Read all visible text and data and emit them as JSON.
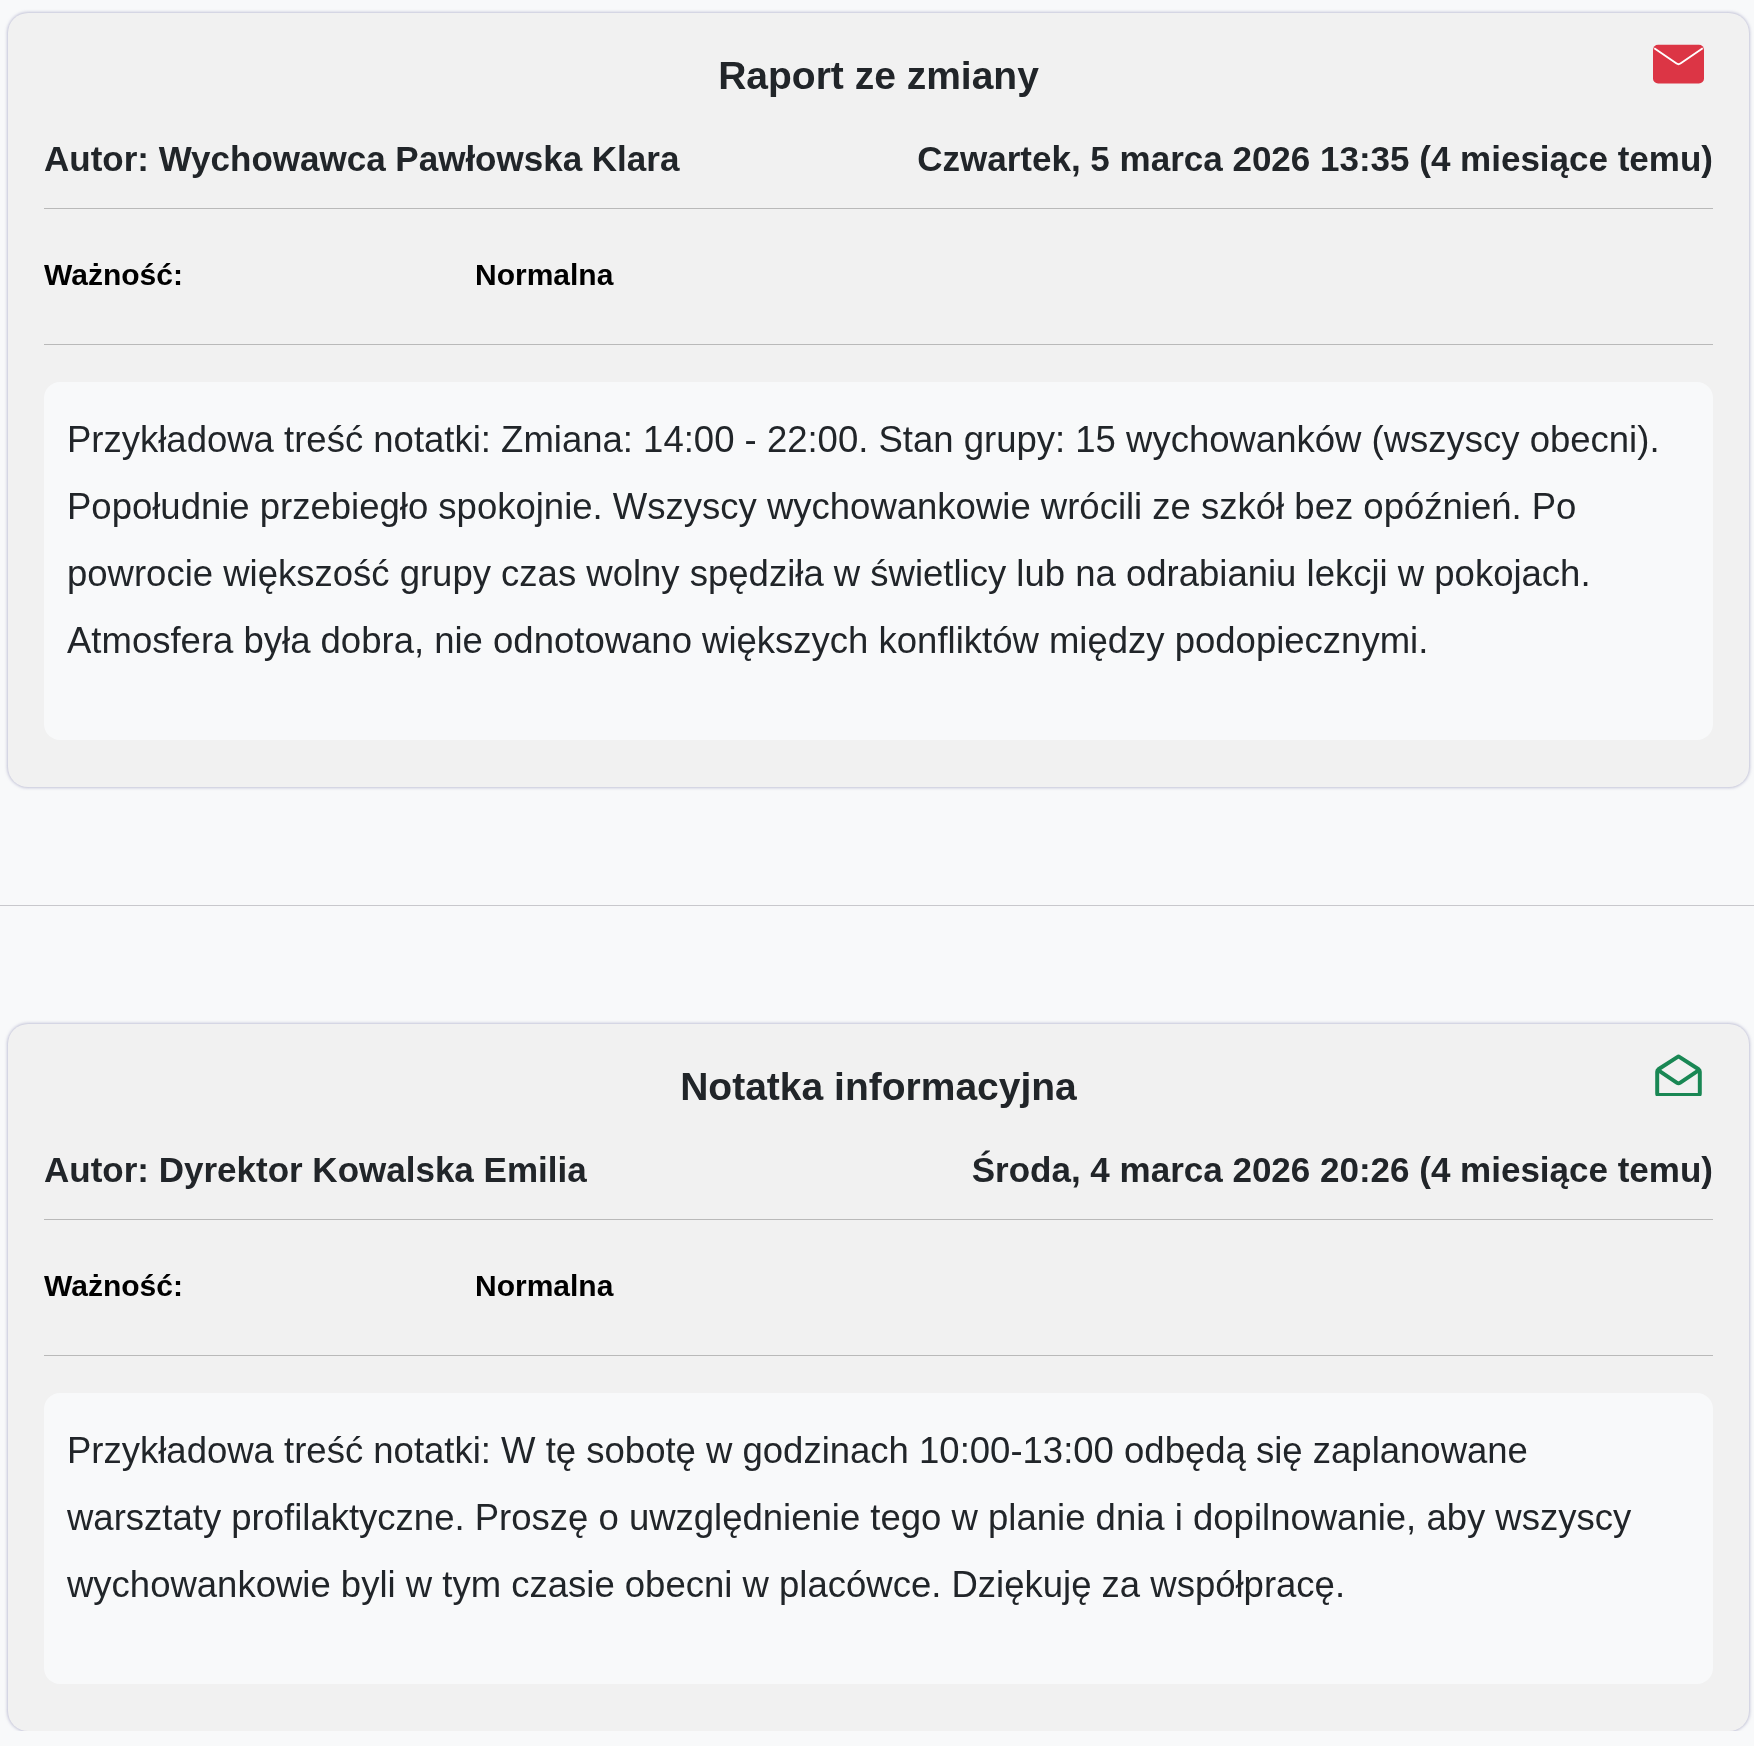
{
  "notes": [
    {
      "title": "Raport ze zmiany",
      "read": false,
      "author": "Autor: Wychowawca Pawłowska Klara",
      "date": "Czwartek, 5 marca 2026 13:35 (4 miesiące temu)",
      "fields": [
        {
          "label": "Ważność:",
          "value": "Normalna"
        }
      ],
      "body": "Przykładowa treść notatki: Zmiana: 14:00 - 22:00. Stan grupy: 15 wychowanków (wszyscy obecni). Popołudnie przebiegło spokojnie. Wszyscy wychowankowie wrócili ze szkół bez opóźnień. Po powrocie większość grupy czas wolny spędziła w świetlicy lub na odrabianiu lekcji w pokojach. Atmosfera była dobra, nie odnotowano większych konfliktów między podopiecznymi."
    },
    {
      "title": "Notatka informacyjna",
      "read": true,
      "author": "Autor: Dyrektor Kowalska Emilia",
      "date": "Środa, 4 marca 2026 20:26 (4 miesiące temu)",
      "fields": [
        {
          "label": "Ważność:",
          "value": "Normalna"
        }
      ],
      "body": "Przykładowa treść notatki: W tę sobotę w godzinach 10:00-13:00 odbędą się zaplanowane warsztaty profilaktyczne. Proszę o uwzględnienie tego w planie dnia i dopilnowanie, aby wszyscy wychowankowie byli w tym czasie obecni w placówce. Dziękuję za współpracę."
    }
  ]
}
